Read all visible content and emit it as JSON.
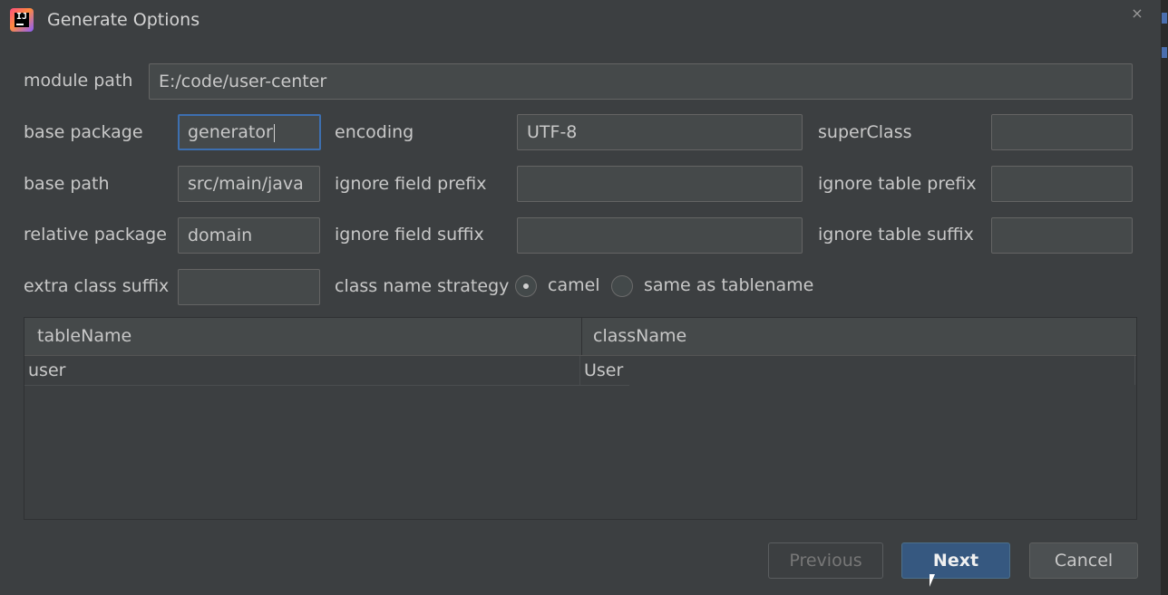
{
  "window": {
    "title": "Generate Options",
    "close_glyph": "×"
  },
  "form": {
    "module_path_label": "module path",
    "module_path_value": "E:/code/user-center",
    "base_package_label": "base package",
    "base_package_value": "generator",
    "encoding_label": "encoding",
    "encoding_value": "UTF-8",
    "superclass_label": "superClass",
    "superclass_value": "",
    "base_path_label": "base path",
    "base_path_value": "src/main/java",
    "ignore_field_prefix_label": "ignore field prefix",
    "ignore_field_prefix_value": "",
    "ignore_table_prefix_label": "ignore table prefix",
    "ignore_table_prefix_value": "",
    "relative_package_label": "relative package",
    "relative_package_value": "domain",
    "ignore_field_suffix_label": "ignore field suffix",
    "ignore_field_suffix_value": "",
    "ignore_table_suffix_label": "ignore table suffix",
    "ignore_table_suffix_value": "",
    "extra_class_suffix_label": "extra class suffix",
    "extra_class_suffix_value": "",
    "class_name_strategy_label": "class name strategy",
    "strategy_options": [
      {
        "label": "camel",
        "selected": true
      },
      {
        "label": "same as tablename",
        "selected": false
      }
    ]
  },
  "table": {
    "headers": [
      "tableName",
      "className"
    ],
    "rows": [
      [
        "user",
        "User"
      ]
    ]
  },
  "buttons": {
    "previous": "Previous",
    "next": "Next",
    "cancel": "Cancel"
  },
  "colors": {
    "background": "#3c3f41",
    "accent": "#365880",
    "focus_border": "#3d6fb0"
  }
}
